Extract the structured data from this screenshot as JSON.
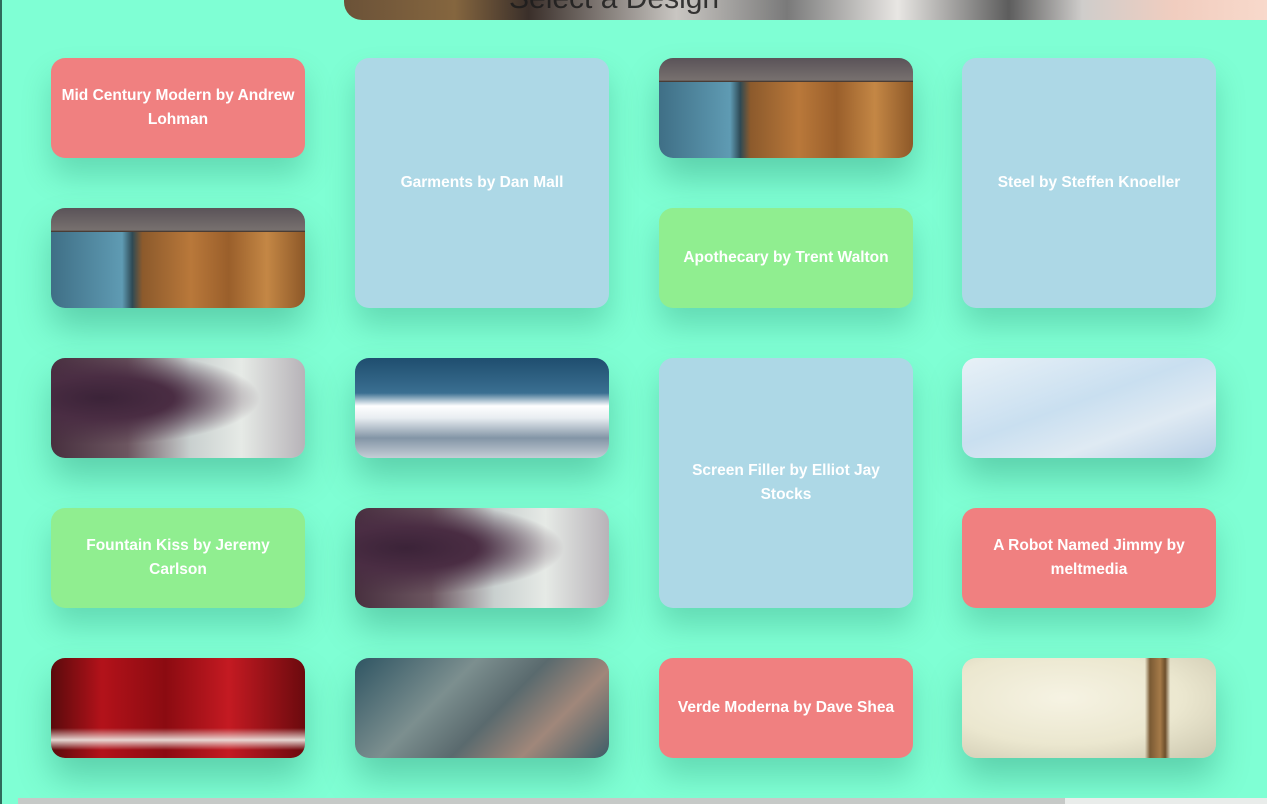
{
  "banner": {
    "text": "Select a Design"
  },
  "tiles": {
    "mid_century": "Mid Century Modern by Andrew Lohman",
    "garments": "Garments by Dan Mall",
    "steel": "Steel by Steffen Knoeller",
    "apothecary": "Apothecary by Trent Walton",
    "screen_filler": "Screen Filler by Elliot Jay Stocks",
    "fountain_kiss": "Fountain Kiss by Jeremy Carlson",
    "robot_jimmy": "A Robot Named Jimmy by meltmedia",
    "verde_moderna": "Verde Moderna by Dave Shea"
  },
  "colors": {
    "background": "#7fffd4",
    "pink_tile": "#f08080",
    "blue_tile": "#add8e6",
    "green_tile": "#90ee90"
  }
}
